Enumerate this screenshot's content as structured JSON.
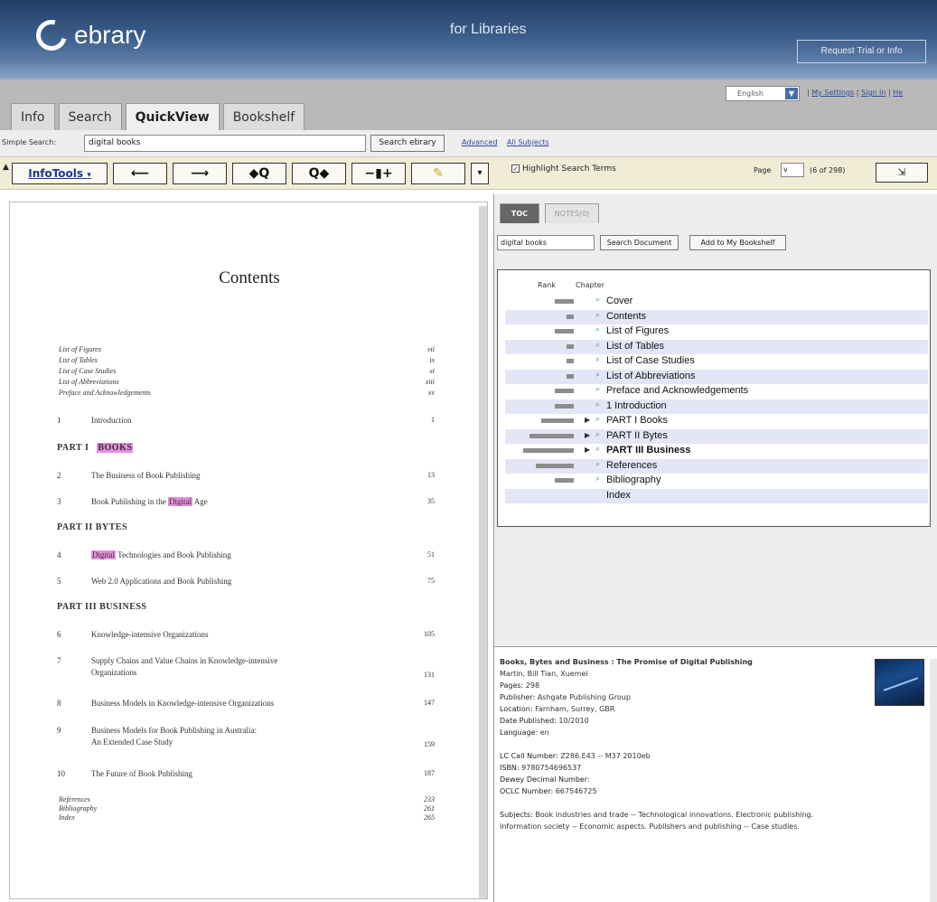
{
  "header": {
    "logo_text": "ebrary",
    "tagline": "for Libraries",
    "trial_button": "Request Trial or Info"
  },
  "topbar": {
    "language": "English",
    "links": [
      "My Settings",
      "Sign In",
      "He"
    ]
  },
  "tabs": [
    {
      "label": "Info",
      "active": false
    },
    {
      "label": "Search",
      "active": false
    },
    {
      "label": "QuickView",
      "active": true
    },
    {
      "label": "Bookshelf",
      "active": false
    }
  ],
  "search": {
    "label": "Simple Search:",
    "value": "digital books",
    "button": "Search ebrary",
    "advanced_link": "Advanced",
    "all_subjects_link": "All Subjects"
  },
  "toolbar": {
    "infotools": "InfoTools",
    "back": "⟵",
    "forward": "⟶",
    "prev_hit": "◆Q",
    "next_hit": "Q◆",
    "zoom": "−▮+",
    "highlight_tool": "✎",
    "collapse": "▾",
    "highlight_label": "Highlight Search Terms",
    "highlight_checked": true,
    "page_label": "Page",
    "page_select": "v",
    "page_count": "(6 of 298)",
    "fit_button": "⇲"
  },
  "document": {
    "heading": "Contents",
    "front_matter": [
      {
        "title": "List of Figures",
        "page": "vii"
      },
      {
        "title": "List of Tables",
        "page": "ix"
      },
      {
        "title": "List of Case Studies",
        "page": "xi"
      },
      {
        "title": "List of Abbreviations",
        "page": "xiii"
      },
      {
        "title": "Preface and Acknowledgements",
        "page": "xv"
      }
    ],
    "chapter1": {
      "num": "1",
      "title": "Introduction",
      "page": "1"
    },
    "part1": {
      "prefix": "PART I",
      "name": "BOOKS"
    },
    "chapter2": {
      "num": "2",
      "title": "The Business of Book Publishing",
      "page": "13"
    },
    "chapter3": {
      "num": "3",
      "title_before": "Book Publishing in the ",
      "hit": "Digital",
      "title_after": " Age",
      "page": "35"
    },
    "part2": {
      "label": "PART II   BYTES"
    },
    "chapter4": {
      "num": "4",
      "hit": "Digital",
      "title_after": " Technologies and Book Publishing",
      "page": "51"
    },
    "chapter5": {
      "num": "5",
      "title": "Web 2.0 Applications and Book Publishing",
      "page": "75"
    },
    "part3": {
      "label": "PART III   BUSINESS"
    },
    "chapter6": {
      "num": "6",
      "title": "Knowledge-intensive Organizations",
      "page": "105"
    },
    "chapter7": {
      "num": "7",
      "title_line1": "Supply Chains and Value Chains in Knowledge-intensive",
      "title_line2": "Organizations",
      "page": "131"
    },
    "chapter8": {
      "num": "8",
      "title": "Business Models in Knowledge-intensive Organizations",
      "page": "147"
    },
    "chapter9": {
      "num": "9",
      "title_line1": "Business Models for Book Publishing in Australia:",
      "title_line2": "An Extended Case Study",
      "page": "159"
    },
    "chapter10": {
      "num": "10",
      "title": "The Future of Book Publishing",
      "page": "187"
    },
    "back_matter": [
      {
        "title": "References",
        "page": "233"
      },
      {
        "title": "Bibliography",
        "page": "261"
      },
      {
        "title": "Index",
        "page": "265"
      }
    ]
  },
  "panel": {
    "tab_toc": "TOC",
    "tab_notes": "NOTES(0)",
    "search_value": "digital books",
    "search_button": "Search Document",
    "bookshelf_button": "Add to My Bookshelf",
    "col_rank": "Rank",
    "col_chapter": "Chapter",
    "toc": [
      {
        "label": "Cover",
        "rank": 0.38,
        "expand": false,
        "icon": true,
        "bold": false
      },
      {
        "label": "Contents",
        "rank": 0.15,
        "expand": false,
        "icon": true,
        "bold": false
      },
      {
        "label": "List of Figures",
        "rank": 0.38,
        "expand": false,
        "icon": true,
        "bold": false
      },
      {
        "label": "List of Tables",
        "rank": 0.15,
        "expand": false,
        "icon": true,
        "bold": false
      },
      {
        "label": "List of Case Studies",
        "rank": 0.15,
        "expand": false,
        "icon": true,
        "bold": false
      },
      {
        "label": "List of Abbreviations",
        "rank": 0.15,
        "expand": false,
        "icon": true,
        "bold": false
      },
      {
        "label": "Preface and Acknowledgements",
        "rank": 0.38,
        "expand": false,
        "icon": true,
        "bold": false
      },
      {
        "label": "1 Introduction",
        "rank": 0.38,
        "expand": false,
        "icon": true,
        "bold": false
      },
      {
        "label": "PART I Books",
        "rank": 0.65,
        "expand": true,
        "icon": true,
        "bold": false
      },
      {
        "label": "PART II Bytes",
        "rank": 0.88,
        "expand": true,
        "icon": true,
        "bold": false
      },
      {
        "label": "PART III Business",
        "rank": 1.0,
        "expand": true,
        "icon": true,
        "bold": true
      },
      {
        "label": "References",
        "rank": 0.75,
        "expand": false,
        "icon": true,
        "bold": false
      },
      {
        "label": "Bibliography",
        "rank": 0.38,
        "expand": false,
        "icon": true,
        "bold": false
      },
      {
        "label": "Index",
        "rank": 0,
        "expand": false,
        "icon": false,
        "bold": false
      }
    ],
    "info": {
      "title": "Books, Bytes and Business : The Promise of Digital Publishing",
      "authors": "Martin, Bill Tian, Xuemei",
      "pages_label": "Pages:",
      "pages": "298",
      "publisher_label": "Publisher:",
      "publisher": "Ashgate Publishing Group",
      "location_label": "Location:",
      "location": "Farnham, Surrey, GBR",
      "date_label": "Date Published:",
      "date": "10/2010",
      "language_label": "Language:",
      "language": "en",
      "lc_label": "LC Call Number:",
      "lc": "Z286.E43 -- M37 2010eb",
      "isbn_label": "ISBN:",
      "isbn": "9780754696537",
      "dewey_label": "Dewey Decimal Number:",
      "dewey": "",
      "oclc_label": "OCLC Number:",
      "oclc": "667546725",
      "subjects_label": "Subjects:",
      "subjects_line1": "Book industries and trade -- Technological innovations.   Electronic publishing.",
      "subjects_line2": "Information society -- Economic aspects.   Publishers and publishing -- Case studies."
    }
  }
}
